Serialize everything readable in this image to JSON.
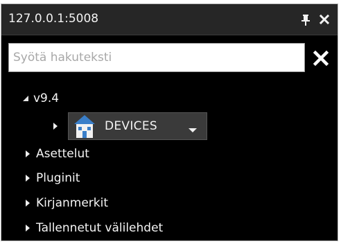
{
  "window": {
    "title": "127.0.0.1:5008",
    "icons": [
      "pin-icon",
      "close-icon"
    ]
  },
  "search": {
    "value": "",
    "placeholder": "Syötä hakuteksti",
    "clear_icon": "clear-icon"
  },
  "tree": {
    "root": {
      "label": "v9.4",
      "expanded": true
    },
    "device": {
      "label": "DEVICES",
      "icon": "house-icon",
      "dropdown_icon": "chevron-down-icon"
    },
    "items": [
      {
        "label": "Asettelut"
      },
      {
        "label": "Pluginit"
      },
      {
        "label": "Kirjanmerkit"
      },
      {
        "label": "Tallennetut välilehdet"
      }
    ]
  },
  "colors": {
    "panel_bg": "#000000",
    "titlebar_bg": "#262626",
    "text": "#f4f4f4",
    "house_roof": "#3a7fc9"
  }
}
